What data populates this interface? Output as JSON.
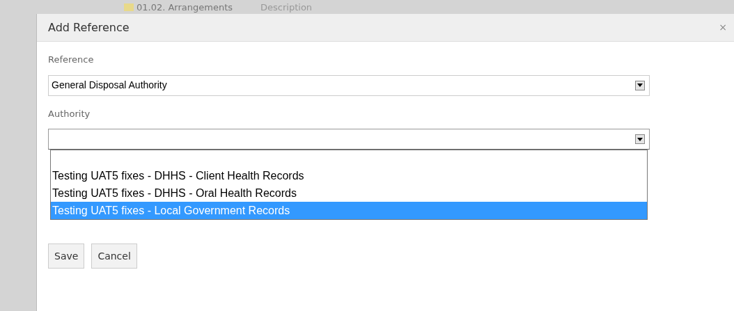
{
  "background": {
    "tree_item": "01.02. Arrangements",
    "column_header": "Description"
  },
  "dialog": {
    "title": "Add Reference",
    "close": "×",
    "fields": [
      {
        "label": "Reference",
        "value": "General Disposal Authority",
        "expanded": false
      },
      {
        "label": "Authority",
        "expanded": true
      }
    ],
    "options": [
      {
        "label": "Testing UAT5 fixes - DHHS - Client Health Records",
        "selected": false
      },
      {
        "label": "Testing UAT5 fixes - DHHS - Oral Health Records",
        "selected": false
      },
      {
        "label": "Testing UAT5 fixes - Local Government Records",
        "selected": true
      }
    ],
    "buttons": [
      "Save",
      "Cancel"
    ]
  }
}
